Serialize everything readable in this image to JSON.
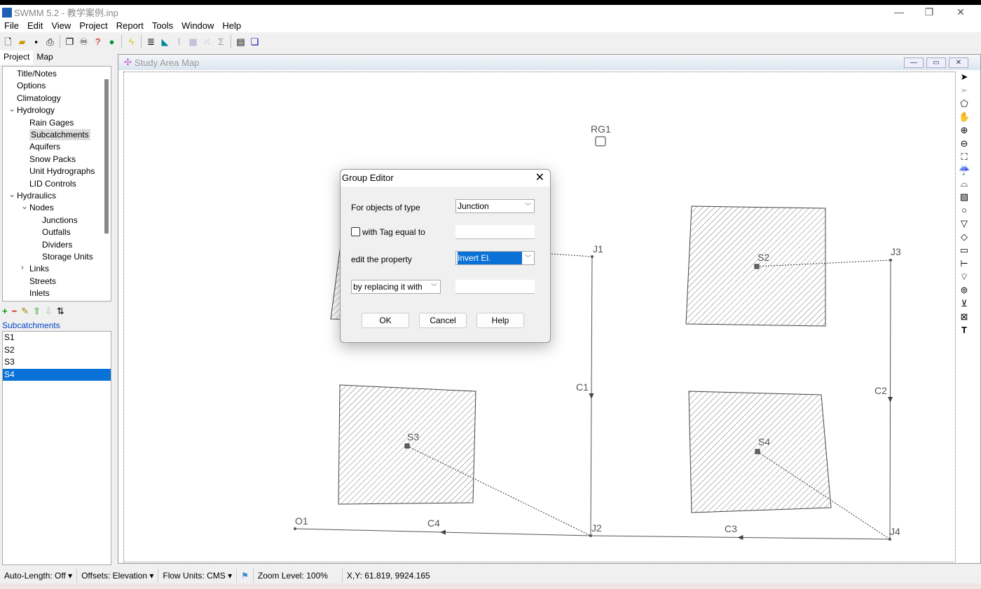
{
  "app": {
    "title": "SWMM 5.2 - 教学案例.inp",
    "minimize": "—",
    "restore": "❐",
    "close": "✕"
  },
  "menu": [
    "File",
    "Edit",
    "View",
    "Project",
    "Report",
    "Tools",
    "Window",
    "Help"
  ],
  "toolbar_icons": [
    "new-icon",
    "open-icon",
    "save-icon",
    "print-icon",
    "copy-icon",
    "find-icon",
    "query-icon",
    "map-icon",
    "run-icon",
    "report-icon",
    "profile-icon",
    "timeseries-icon",
    "table-icon",
    "scatter-icon",
    "statistics-icon",
    "options-icon",
    "cascade-icon"
  ],
  "left": {
    "tabs": [
      "Project",
      "Map"
    ],
    "tree": [
      "Title/Notes",
      "Options",
      "Climatology",
      "Hydrology",
      "Rain Gages",
      "Subcatchments",
      "Aquifers",
      "Snow Packs",
      "Unit Hydrographs",
      "LID Controls",
      "Hydraulics",
      "Nodes",
      "Junctions",
      "Outfalls",
      "Dividers",
      "Storage Units",
      "Links",
      "Streets",
      "Inlets"
    ],
    "selected_tree": "Subcatchments",
    "list_header": "Subcatchments",
    "items": [
      "S1",
      "S2",
      "S3",
      "S4"
    ],
    "selected_item": "S4"
  },
  "map": {
    "title": "Study Area Map",
    "labels": {
      "RG1": "RG1",
      "J1": "J1",
      "J2": "J2",
      "J3": "J3",
      "J4": "J4",
      "O1": "O1",
      "C1": "C1",
      "C2": "C2",
      "C3": "C3",
      "C4": "C4",
      "S2": "S2",
      "S3": "S3",
      "S4": "S4"
    }
  },
  "dialog": {
    "title": "Group Editor",
    "object_type_label": "For objects of type",
    "object_type": "Junction",
    "tag_label": "with Tag equal to",
    "tag_checked": false,
    "tag_value": "",
    "property_label": "edit the property",
    "property": "Invert El.",
    "action": "by replacing it with",
    "value": "",
    "ok": "OK",
    "cancel": "Cancel",
    "help": "Help"
  },
  "status": {
    "auto_length": "Auto-Length: Off",
    "offsets": "Offsets: Elevation",
    "flow_units": "Flow Units: CMS",
    "zoom": "Zoom Level: 100%",
    "xy": "X,Y: 61.819, 9924.165"
  },
  "colors": {
    "selection": "#0a72d6",
    "link_header": "#0645c8"
  }
}
